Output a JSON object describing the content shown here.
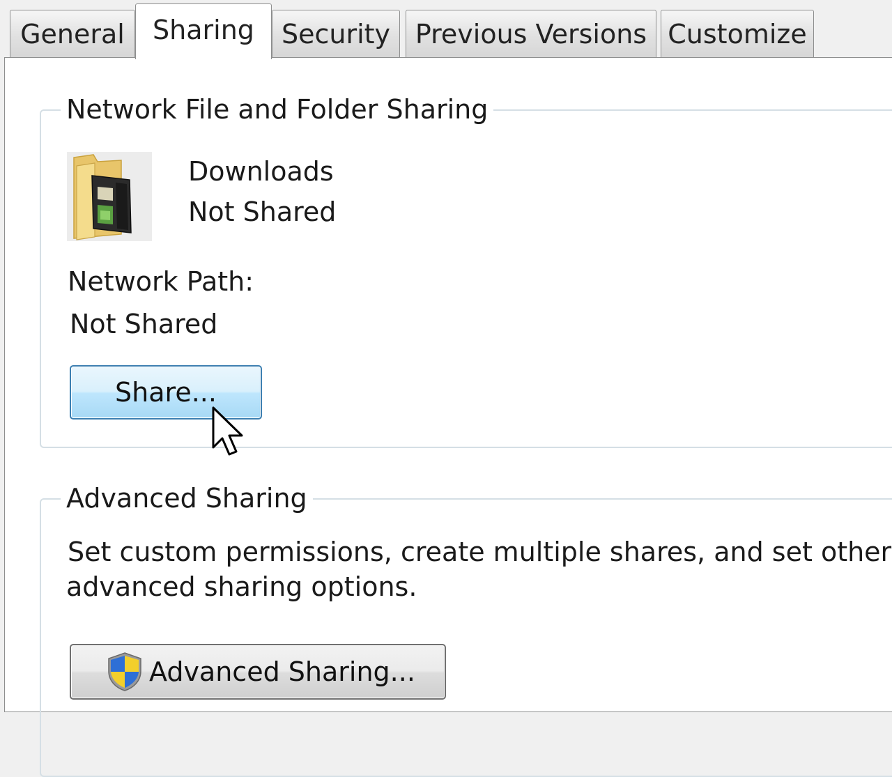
{
  "tabs": [
    {
      "label": "General",
      "active": false
    },
    {
      "label": "Sharing",
      "active": true
    },
    {
      "label": "Security",
      "active": false
    },
    {
      "label": "Previous Versions",
      "active": false
    },
    {
      "label": "Customize",
      "active": false
    }
  ],
  "network_sharing": {
    "title": "Network File and Folder Sharing",
    "folder_icon": "folder-icon",
    "folder_name": "Downloads",
    "folder_status": "Not Shared",
    "path_label": "Network Path:",
    "path_value": "Not Shared",
    "share_button_label": "Share..."
  },
  "advanced_sharing": {
    "title": "Advanced Sharing",
    "description_line1": "Set custom permissions, create multiple shares, and set other",
    "description_line2": "advanced sharing options.",
    "button_icon": "uac-shield-icon",
    "button_label": "Advanced Sharing..."
  },
  "colors": {
    "window_bg": "#f0f0f0",
    "panel_bg": "#ffffff",
    "group_border": "#d5dfe5",
    "share_button_border": "#3c7fb1",
    "share_button_fill": "#bee6fd"
  }
}
